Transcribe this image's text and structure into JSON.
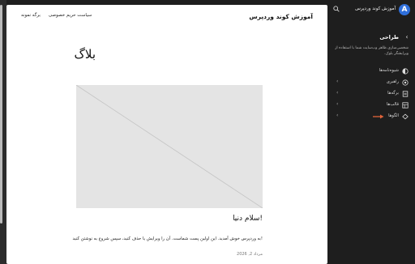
{
  "preview": {
    "site_title": "آموزش کوند وردپرس",
    "nav": [
      "برگه نمونه",
      "سیاست حریم خصوصی"
    ],
    "page_heading": "بلاگ",
    "post": {
      "title": "سلام دنیا!",
      "excerpt": "به وردپرس خوش آمدید. این اولین پست شماست. آن را ویرایش یا حذف کنید، سپس شروع به نوشتن کنید!",
      "date": "مرداد 2, 2026"
    }
  },
  "sidebar": {
    "site_name": "آموزش کوند وردپرس",
    "section_title": "طراحی",
    "description": "شخصی‌سازی ظاهر وب‌سایت شما با استفاده از ویرایشگر بلوک.",
    "items": [
      {
        "label": "شیوه‌نامه‌ها",
        "icon": "half-circle-icon",
        "has_chevron": false
      },
      {
        "label": "راهبری",
        "icon": "navigation-icon",
        "has_chevron": true
      },
      {
        "label": "برگه‌ها",
        "icon": "page-icon",
        "has_chevron": true
      },
      {
        "label": "قالب‌ها",
        "icon": "template-icon",
        "has_chevron": true
      },
      {
        "label": "الگوها",
        "icon": "pattern-icon",
        "has_chevron": true
      }
    ]
  },
  "colors": {
    "accent_arrow": "#e2643a",
    "logo_blue": "#2f6fdb"
  }
}
